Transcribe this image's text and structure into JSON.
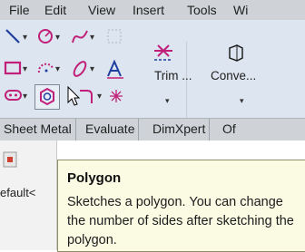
{
  "menu": {
    "items": [
      "File",
      "Edit",
      "View",
      "Insert",
      "Tools",
      "Wi"
    ]
  },
  "ribbon": {
    "trim_label": "Trim ...",
    "convert_label": "Conve...",
    "trim_mnemonic": "T",
    "tools_row1": [
      "line-icon",
      "circle-icon",
      "spline-icon",
      "rectangle-select-icon"
    ],
    "tools_row2": [
      "rectangle-icon",
      "arc-icon",
      "ellipse-icon",
      "text-icon"
    ],
    "tools_row3": [
      "slot-icon",
      "polygon-icon",
      "fillet-icon",
      "point-icon"
    ]
  },
  "tabs": {
    "items": [
      "Sheet Metal",
      "Evaluate",
      "DimXpert",
      "Of"
    ]
  },
  "panel": {
    "config_text": "efault<"
  },
  "tooltip": {
    "title": "Polygon",
    "body": "Sketches a polygon. You can change the number of sides after sketching the polygon."
  },
  "colors": {
    "ribbon_bg": "#dde6f0",
    "sketch_blue": "#1f3f9f",
    "accent_magenta": "#c0207a",
    "tooltip_bg": "#fbfbe4"
  }
}
